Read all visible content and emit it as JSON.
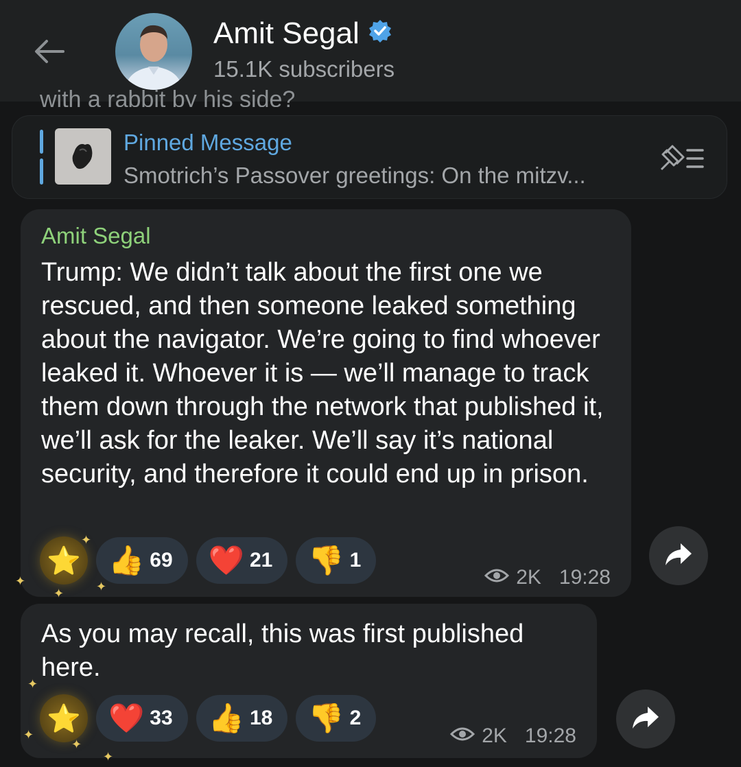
{
  "header": {
    "title": "Amit Segal",
    "subtitle": "15.1K subscribers"
  },
  "cutoff_text": "with a rabbit by his side?",
  "pinned": {
    "label": "Pinned Message",
    "preview": "Smotrich’s Passover greetings:  On the mitzv..."
  },
  "messages": [
    {
      "sender": "Amit Segal",
      "text": "Trump: We didn’t talk about the first one we rescued, and then someone leaked something about the navigator. We’re going to find whoever leaked it. Whoever it is — we’ll manage to track them down through the network that published it, we’ll ask for the leaker. We’ll say it’s national security, and therefore it could end up in prison.",
      "reactions": [
        {
          "emoji": "👍",
          "count": "69"
        },
        {
          "emoji": "❤️",
          "count": "21"
        },
        {
          "emoji": "👎",
          "count": "1"
        }
      ],
      "views": "2K",
      "time": "19:28"
    },
    {
      "text": "As you may recall, this was first published here.",
      "reactions": [
        {
          "emoji": "❤️",
          "count": "33"
        },
        {
          "emoji": "👍",
          "count": "18"
        },
        {
          "emoji": "👎",
          "count": "2"
        }
      ],
      "views": "2K",
      "time": "19:28"
    }
  ],
  "icons": {
    "star": "⭐",
    "verified_color": "#4fa3e8"
  }
}
